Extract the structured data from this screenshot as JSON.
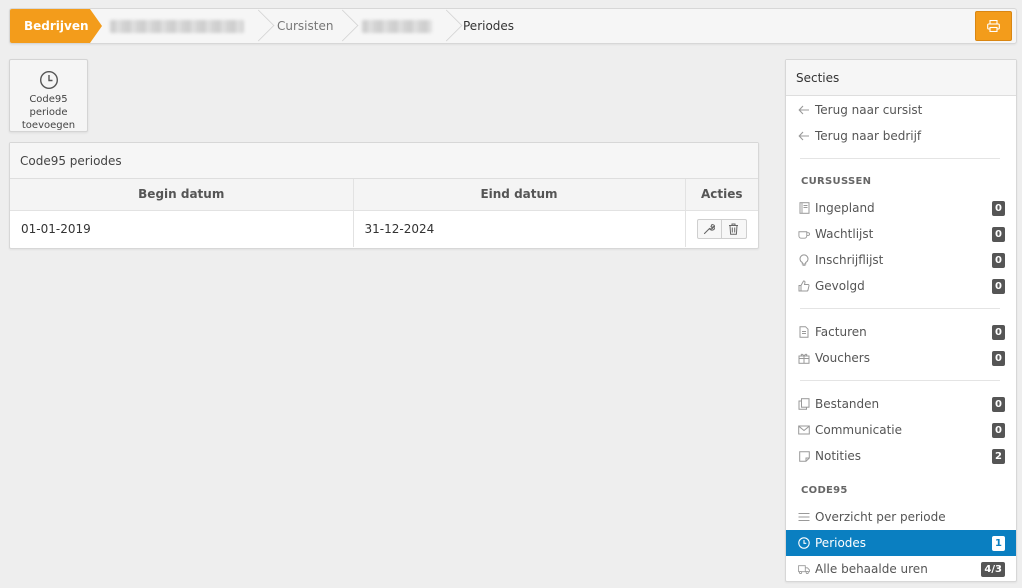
{
  "breadcrumb": {
    "item1": "Bedrijven",
    "item3": "Cursisten",
    "item5": "Periodes"
  },
  "colors": {
    "accent": "#f39c1b",
    "active": "#0a7fc1"
  },
  "toolbar": {
    "add_period_label_line1": "Code95 periode",
    "add_period_label_line2": "toevoegen"
  },
  "panel": {
    "title": "Code95 periodes",
    "columns": [
      "Begin datum",
      "Eind datum",
      "Acties"
    ],
    "rows": [
      {
        "begin": "01-01-2019",
        "end": "31-12-2024"
      }
    ]
  },
  "sidebar": {
    "title": "Secties",
    "back_to_student": "Terug naar cursist",
    "back_to_company": "Terug naar bedrijf",
    "courses_caption": "CURSUSSEN",
    "planned": {
      "label": "Ingepland",
      "count": "0"
    },
    "waitlist": {
      "label": "Wachtlijst",
      "count": "0"
    },
    "signup_list": {
      "label": "Inschrijflijst",
      "count": "0"
    },
    "followed": {
      "label": "Gevolgd",
      "count": "0"
    },
    "invoices": {
      "label": "Facturen",
      "count": "0"
    },
    "vouchers": {
      "label": "Vouchers",
      "count": "0"
    },
    "files": {
      "label": "Bestanden",
      "count": "0"
    },
    "communication": {
      "label": "Communicatie",
      "count": "0"
    },
    "notes": {
      "label": "Notities",
      "count": "2"
    },
    "code95_caption": "CODE95",
    "overview": {
      "label": "Overzicht per periode"
    },
    "periods": {
      "label": "Periodes",
      "count": "1"
    },
    "hours": {
      "label": "Alle behaalde uren",
      "count": "4/3"
    }
  }
}
